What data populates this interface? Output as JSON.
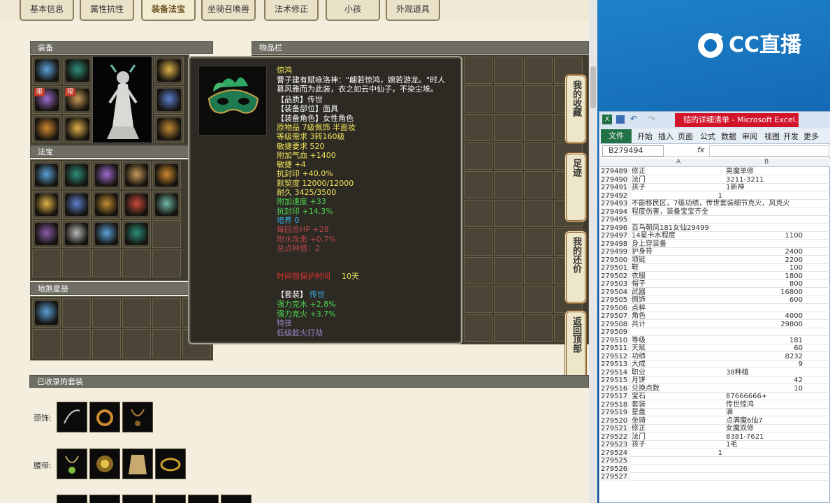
{
  "tabs": [
    "基本信息",
    "属性抗性",
    "装备法宝",
    "坐骑召唤兽",
    "法术修正",
    "小孩",
    "外观道具"
  ],
  "active_tab": "装备法宝",
  "panels": {
    "equip": "装备",
    "fabao": "法宝",
    "dishaxing": "地煞星册",
    "inventory": "物品栏",
    "sets": "已收录的套装"
  },
  "lock_label": "限",
  "tooltip": {
    "name": "惊鸿",
    "desc1": "曹子建有赋咏洛神：\"翩若惊鸿，婉若游龙。\"时人",
    "desc2": "慕风雅而为此装，衣之如云中仙子，不染尘埃。",
    "lines": [
      {
        "t": "【品质】传世",
        "c": "#ffffff"
      },
      {
        "t": "【装备部位】面具",
        "c": "#ffffff"
      },
      {
        "t": "【装备角色】女性角色",
        "c": "#ffffff"
      },
      {
        "t": "原物品 7级佩饰 半面妆",
        "c": "#f3e45c"
      },
      {
        "t": "等级需求 3转160级",
        "c": "#f3e45c"
      },
      {
        "t": "敏捷要求 520",
        "c": "#f3e45c"
      },
      {
        "t": "附加气血 +1400",
        "c": "#f3e45c"
      },
      {
        "t": "敏捷 +4",
        "c": "#f3e45c"
      },
      {
        "t": "抗封印 +40.0%",
        "c": "#f3e45c"
      },
      {
        "t": "默契度 12000/12000",
        "c": "#f3e45c"
      },
      {
        "t": "耐久 3425/3500",
        "c": "#f3e45c"
      },
      {
        "t": "附加速度 +33",
        "c": "#4ed653"
      },
      {
        "t": "抗封印 +14.3%",
        "c": "#4ed653"
      },
      {
        "t": "培养 0",
        "c": "#39b4f0"
      },
      {
        "t": "每回合HP +28",
        "c": "#b8474a"
      },
      {
        "t": "附水攻击 +0.7%",
        "c": "#b8474a"
      },
      {
        "t": "总点种值：2",
        "c": "#b8474a"
      }
    ],
    "protect_label": "时间锁保护时间",
    "protect_value": "10天",
    "set_label": "【套装】",
    "set_name": "传世",
    "set_lines": [
      {
        "t": "强力克水 +2.8%",
        "c": "#4ed653"
      },
      {
        "t": "强力克火 +3.7%",
        "c": "#4ed653"
      },
      {
        "t": "特技",
        "c": "#9b87c8"
      },
      {
        "t": "低级趁火打劫",
        "c": "#9b87c8"
      }
    ]
  },
  "side_buttons": [
    "我的收藏",
    "足迹",
    "我的还价",
    "返回顶部"
  ],
  "sets_rows": [
    "颈饰:",
    "腰带:"
  ],
  "excel": {
    "title": "铠的详细清单 - Microsoft Excel...",
    "menu": [
      "开始",
      "插入",
      "页面",
      "公式",
      "数据",
      "审阅",
      "视图",
      "开发",
      "更多"
    ],
    "file_label": "文件",
    "namebox": "B279494",
    "fx": "fx",
    "col_a": "A",
    "col_b": "B",
    "rows": [
      [
        "279489",
        "修正",
        "男魔单修",
        false
      ],
      [
        "279490",
        "法门",
        "3211-3211",
        false
      ],
      [
        "279491",
        "孩子",
        "1新神",
        false
      ],
      [
        "279492",
        "1",
        "",
        false
      ],
      [
        "279493",
        "不能移民区，7级功绩，传世套装细节克火，风克火",
        "",
        false
      ],
      [
        "279494",
        "程度伤害，装备宝宝齐全",
        "",
        false
      ],
      [
        "279495",
        "",
        "",
        false
      ],
      [
        "279496",
        "百鸟朝凤181女仙29499",
        "",
        false
      ],
      [
        "279497",
        "14星卡水程度",
        "1100",
        true
      ],
      [
        "279498",
        "身上穿装备",
        "",
        false
      ],
      [
        "279499",
        "护身符",
        "2400",
        true
      ],
      [
        "279500",
        "项链",
        "2200",
        true
      ],
      [
        "279501",
        "鞋",
        "100",
        true
      ],
      [
        "279502",
        "衣服",
        "1800",
        true
      ],
      [
        "279503",
        "帽子",
        "800",
        true
      ],
      [
        "279504",
        "武器",
        "16800",
        true
      ],
      [
        "279505",
        "佩饰",
        "600",
        true
      ],
      [
        "279506",
        "点粹",
        "",
        false
      ],
      [
        "279507",
        "角色",
        "4000",
        true
      ],
      [
        "279508",
        "共计",
        "29800",
        true
      ],
      [
        "279509",
        "",
        "",
        false
      ],
      [
        "279510",
        "等级",
        "181",
        true
      ],
      [
        "279511",
        "天赋",
        "60",
        true
      ],
      [
        "279512",
        "功绩",
        "8232",
        true
      ],
      [
        "279513",
        "大成",
        "9",
        true
      ],
      [
        "279514",
        "职业",
        "38种植",
        false
      ],
      [
        "279515",
        "月饼",
        "42",
        true
      ],
      [
        "279516",
        "兑换点数",
        "10",
        true
      ],
      [
        "279517",
        "宝石",
        "87666666+",
        false
      ],
      [
        "279518",
        "套装",
        "传世惊鸿",
        false
      ],
      [
        "279519",
        "星盘",
        "满",
        false
      ],
      [
        "279520",
        "坐骑",
        "点满魔6仙7",
        false
      ],
      [
        "279521",
        "修正",
        "女魔双修",
        false
      ],
      [
        "279522",
        "法门",
        "8381-7621",
        false
      ],
      [
        "279523",
        "孩子",
        "1毛",
        false
      ],
      [
        "279524",
        "1",
        "",
        false
      ],
      [
        "279525",
        "",
        "",
        false
      ],
      [
        "279526",
        "",
        "",
        false
      ],
      [
        "279527",
        "",
        "",
        false
      ]
    ]
  },
  "brand": "CC直播"
}
